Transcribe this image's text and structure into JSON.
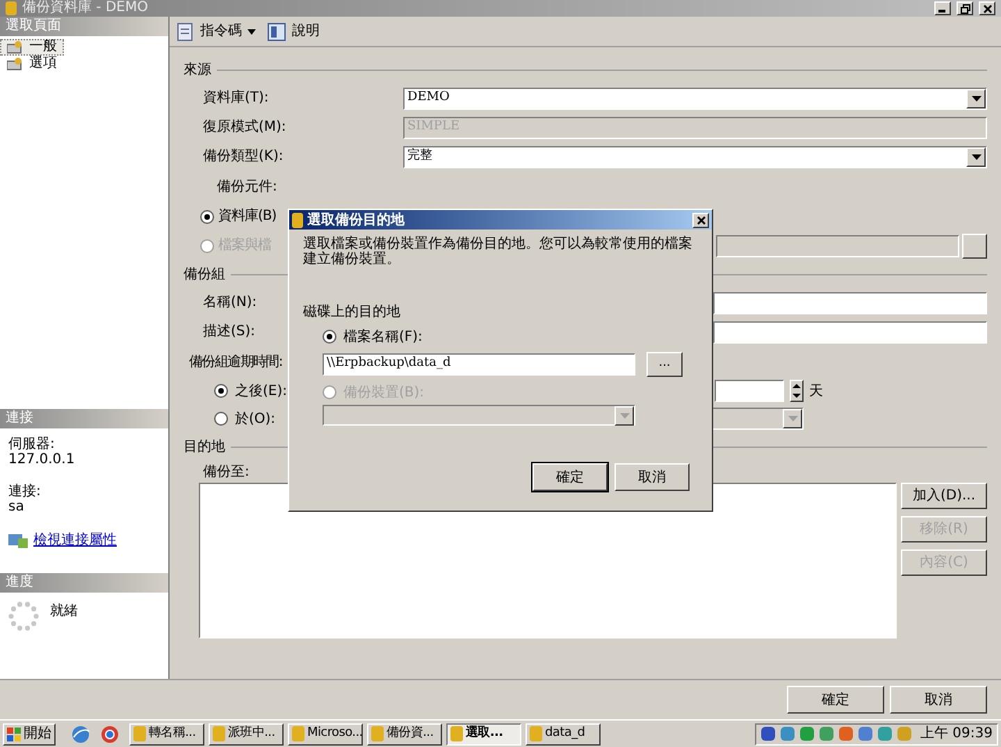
{
  "window": {
    "title": "備份資料庫 - DEMO"
  },
  "sidebar": {
    "header": "選取頁面",
    "pages": [
      {
        "label": "一般",
        "selected": true
      },
      {
        "label": "選項",
        "selected": false
      }
    ],
    "connection": {
      "header": "連接",
      "server_label": "伺服器:",
      "server": "127.0.0.1",
      "login_label": "連接:",
      "login": "sa",
      "link": "檢視連接屬性"
    },
    "progress": {
      "header": "進度",
      "status": "就緒"
    }
  },
  "toolbar": [
    {
      "label": "指令碼",
      "dropdown": true
    },
    {
      "label": "說明",
      "dropdown": false
    }
  ],
  "source": {
    "header": "來源",
    "fields": [
      {
        "label": "資料庫(T):",
        "value": "DEMO",
        "kind": "dropdown",
        "disabled": false
      },
      {
        "label": "復原模式(M):",
        "value": "SIMPLE",
        "kind": "text",
        "disabled": true
      },
      {
        "label": "備份類型(K):",
        "value": "完整",
        "kind": "dropdown",
        "disabled": false
      }
    ],
    "component_label": "備份元件:",
    "components": [
      {
        "label": "資料庫(B)",
        "selected": true,
        "disabled": false
      },
      {
        "label": "檔案與檔",
        "selected": false,
        "disabled": true
      }
    ]
  },
  "backup_set": {
    "header": "備份組",
    "fields": [
      {
        "label": "名稱(N):"
      },
      {
        "label": "描述(S):"
      }
    ],
    "expiry_label": "備份組逾期時間:",
    "expiry": [
      {
        "label": "之後(E):",
        "selected": true,
        "kind": "days",
        "unit": "天"
      },
      {
        "label": "於(O):",
        "selected": false,
        "kind": "date"
      }
    ]
  },
  "destination": {
    "header": "目的地",
    "label": "備份至:",
    "buttons": [
      {
        "label": "加入(D)...",
        "disabled": false
      },
      {
        "label": "移除(R)",
        "disabled": true
      },
      {
        "label": "內容(C)",
        "disabled": true
      }
    ]
  },
  "footer_buttons": [
    "確定",
    "取消"
  ],
  "dialog": {
    "title": "選取備份目的地",
    "description": "選取檔案或備份裝置作為備份目的地。您可以為較常使用的檔案建立備份裝置。",
    "group": "磁碟上的目的地",
    "options": [
      {
        "label": "檔案名稱(F):",
        "selected": true,
        "disabled": false,
        "kind": "file",
        "value": "\\\\Erpbackup\\data_d",
        "browse": "..."
      },
      {
        "label": "備份裝置(B):",
        "selected": false,
        "disabled": true,
        "kind": "device"
      }
    ],
    "buttons": [
      "確定",
      "取消"
    ]
  },
  "taskbar": {
    "start": "開始",
    "tasks": [
      {
        "label": "轉名稱...",
        "selected": false
      },
      {
        "label": "派班中...",
        "selected": false
      },
      {
        "label": "Microso...",
        "selected": false
      },
      {
        "label": "備份資...",
        "selected": false
      },
      {
        "label": "選取...",
        "selected": true
      },
      {
        "label": "data_d",
        "selected": false
      }
    ],
    "clock": "上午 09:39"
  }
}
